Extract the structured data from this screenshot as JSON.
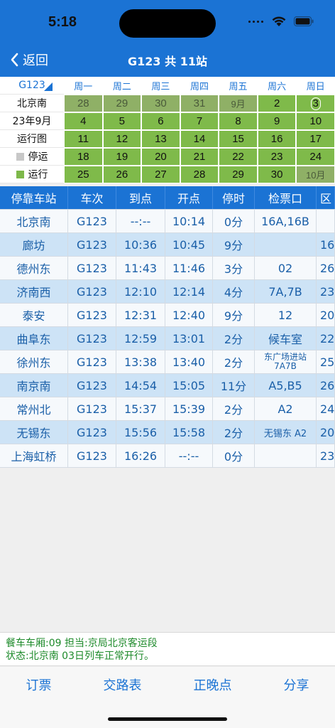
{
  "status": {
    "time": "5:18"
  },
  "nav": {
    "back_label": "返回",
    "title": "G123 共 11站"
  },
  "calendar": {
    "train": "G123",
    "side": [
      "北京南",
      "23年9月",
      "运行图",
      "停运",
      "运行"
    ],
    "weekdays": [
      "周一",
      "周二",
      "周三",
      "周四",
      "周五",
      "周六",
      "周日"
    ],
    "rows": [
      [
        "28",
        "29",
        "30",
        "31",
        "9月",
        "2",
        "3"
      ],
      [
        "4",
        "5",
        "6",
        "7",
        "8",
        "9",
        "10"
      ],
      [
        "11",
        "12",
        "13",
        "14",
        "15",
        "16",
        "17"
      ],
      [
        "18",
        "19",
        "20",
        "21",
        "22",
        "23",
        "24"
      ],
      [
        "25",
        "26",
        "27",
        "28",
        "29",
        "30",
        "10月"
      ]
    ],
    "colors": {
      "run": "#7fba4a",
      "stop": "#c8c8c8",
      "today": "#e02b22"
    }
  },
  "table": {
    "headers": [
      "停靠车站",
      "车次",
      "到点",
      "开点",
      "停时",
      "检票口",
      "区"
    ],
    "rows": [
      [
        "北京南",
        "G123",
        "--:--",
        "10:14",
        "0分",
        "16A,16B",
        ""
      ],
      [
        "廊坊",
        "G123",
        "10:36",
        "10:45",
        "9分",
        "",
        "16"
      ],
      [
        "德州东",
        "G123",
        "11:43",
        "11:46",
        "3分",
        "02",
        "26"
      ],
      [
        "济南西",
        "G123",
        "12:10",
        "12:14",
        "4分",
        "7A,7B",
        "23"
      ],
      [
        "泰安",
        "G123",
        "12:31",
        "12:40",
        "9分",
        "12",
        "20"
      ],
      [
        "曲阜东",
        "G123",
        "12:59",
        "13:01",
        "2分",
        "候车室",
        "22"
      ],
      [
        "徐州东",
        "G123",
        "13:38",
        "13:40",
        "2分",
        "东广场进站 7A7B",
        "25"
      ],
      [
        "南京南",
        "G123",
        "14:54",
        "15:05",
        "11分",
        "A5,B5",
        "26"
      ],
      [
        "常州北",
        "G123",
        "15:37",
        "15:39",
        "2分",
        "A2",
        "24"
      ],
      [
        "无锡东",
        "G123",
        "15:56",
        "15:58",
        "2分",
        "无锡东 A2",
        "20"
      ],
      [
        "上海虹桥",
        "G123",
        "16:26",
        "--:--",
        "0分",
        "",
        "23"
      ]
    ]
  },
  "info": {
    "line1": "餐车车厢:09 担当:京局北京客运段",
    "line2": "状态:北京南 03日列车正常开行。"
  },
  "bottom": {
    "buttons": [
      "订票",
      "交路表",
      "正晚点",
      "分享"
    ]
  }
}
